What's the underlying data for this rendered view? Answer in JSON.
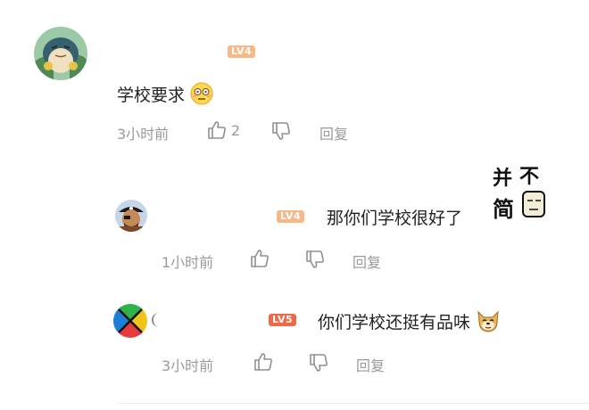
{
  "comments": [
    {
      "level": "LV4",
      "text": "学校要求",
      "time": "3小时前",
      "likes": "2",
      "reply": "回复"
    },
    {
      "level": "LV4",
      "text": "那你们学校很好了",
      "sticker_text": "并不简单",
      "time": "1小时前",
      "reply": "回复"
    },
    {
      "level": "LV5",
      "text": "你们学校还挺有品味",
      "time": "3小时前",
      "reply": "回复"
    }
  ],
  "icons": [
    "snorlax-avatar",
    "pirate-avatar",
    "geometric-avatar",
    "thumbs-up-icon",
    "thumbs-down-icon",
    "awkward-smile-emoji",
    "doge-emoji",
    "not-simple-sticker"
  ]
}
